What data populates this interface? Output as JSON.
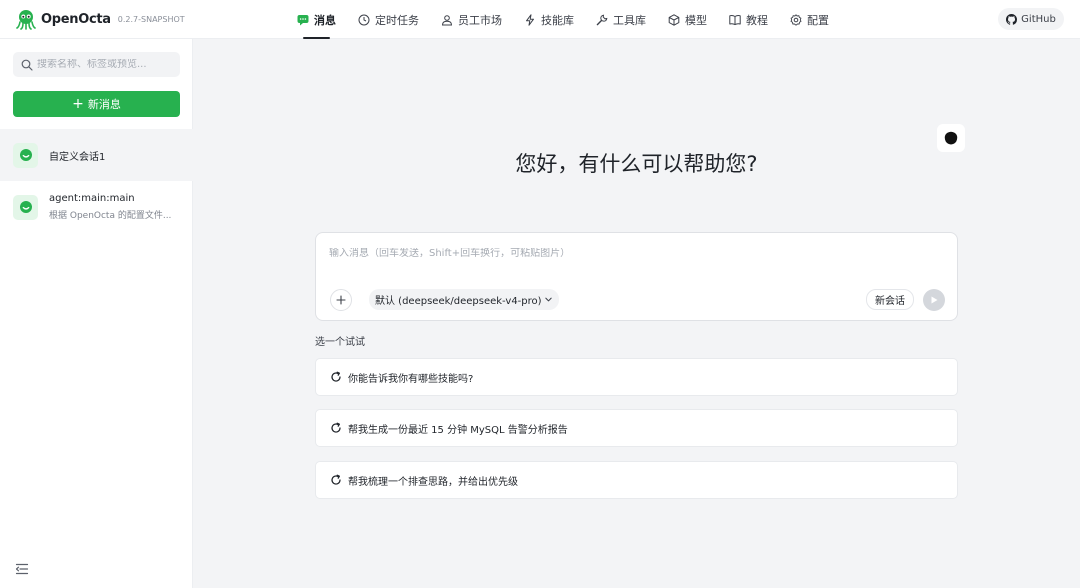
{
  "brand": {
    "name": "OpenOcta",
    "version": "0.2.7-SNAPSHOT"
  },
  "nav": {
    "items": [
      {
        "label": "消息",
        "icon": "message-icon",
        "active": true
      },
      {
        "label": "定时任务",
        "icon": "clock-icon"
      },
      {
        "label": "员工市场",
        "icon": "user-icon"
      },
      {
        "label": "技能库",
        "icon": "lightning-icon"
      },
      {
        "label": "工具库",
        "icon": "wrench-icon"
      },
      {
        "label": "模型",
        "icon": "cube-icon"
      },
      {
        "label": "教程",
        "icon": "book-icon"
      },
      {
        "label": "配置",
        "icon": "gear-icon"
      }
    ],
    "github_label": "GitHub"
  },
  "sidebar": {
    "search_placeholder": "搜索名称、标签或预览...",
    "new_button_label": "新消息",
    "conversations": [
      {
        "title": "自定义会话1",
        "subtitle": "",
        "active": true
      },
      {
        "title": "agent:main:main",
        "subtitle": "根据 OpenOcta 的配置文件..."
      }
    ]
  },
  "main": {
    "greeting": "您好，有什么可以帮助您?",
    "composer": {
      "placeholder": "输入消息（回车发送，Shift+回车换行，可粘贴图片）",
      "model_label": "默认 (deepseek/deepseek-v4-pro)",
      "new_chat_label": "新会话"
    },
    "try_title": "选一个试试",
    "suggestions": [
      "你能告诉我你有哪些技能吗?",
      "帮我生成一份最近 15 分钟 MySQL 告警分析报告",
      "帮我梳理一个排查思路，并给出优先级"
    ]
  },
  "colors": {
    "accent": "#27b14f",
    "accent_light": "#e3f6e8"
  }
}
